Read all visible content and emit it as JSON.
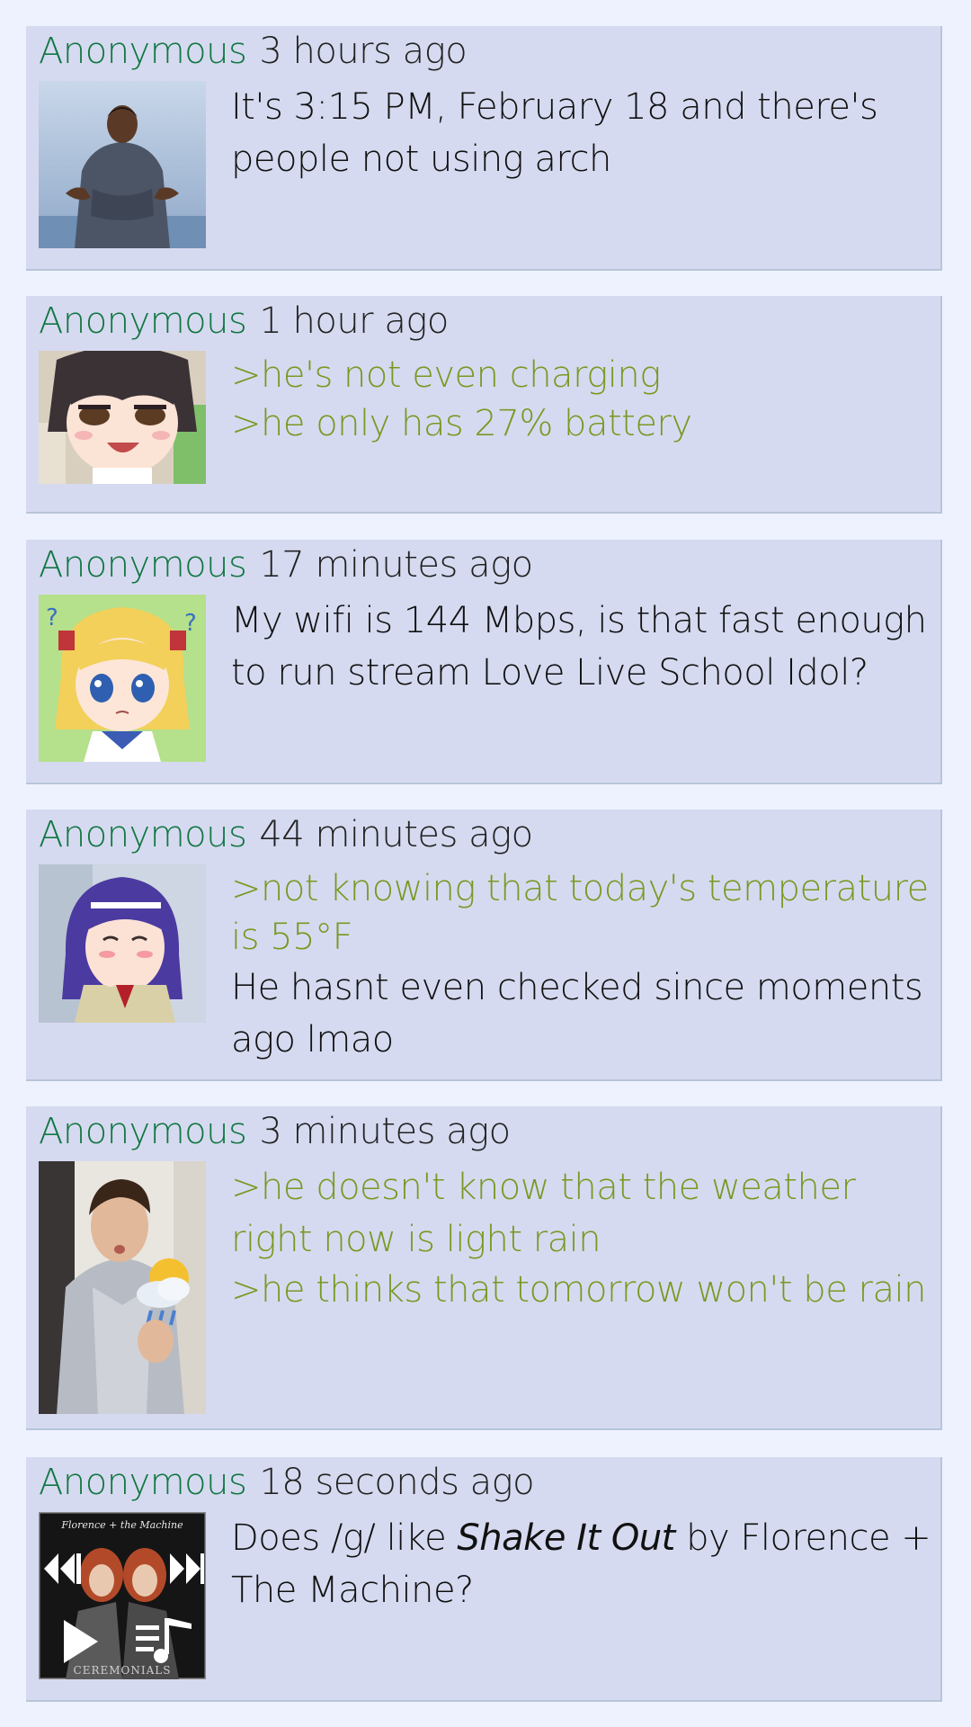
{
  "colors": {
    "background": "#eef2ff",
    "post_background": "#d6daf0",
    "post_border": "#b7c5d9",
    "author": "#117743",
    "greentext": "#789922",
    "text": "#111111"
  },
  "posts": [
    {
      "author": "Anonymous",
      "time": "3 hours ago",
      "thumbnail": "man-in-hoodie-image",
      "lines": [
        "It's 3:15 PM, February 18 and there's people not using arch"
      ]
    },
    {
      "author": "Anonymous",
      "time": "1 hour ago",
      "thumbnail": "smug-anime-girl-image",
      "quotes": [
        ">he's not even charging",
        ">he only has 27% battery"
      ]
    },
    {
      "author": "Anonymous",
      "time": "17 minutes ago",
      "thumbnail": "confused-anime-girl-image",
      "lines": [
        "My wifi is 144 Mbps, is that fast enough to run stream Love Live School Idol?"
      ]
    },
    {
      "author": "Anonymous",
      "time": "44 minutes ago",
      "thumbnail": "laughing-anime-girl-image",
      "quotes": [
        ">not knowing that today's temperature is 55°F"
      ],
      "lines": [
        "He hasnt even checked since moments ago lmao"
      ]
    },
    {
      "author": "Anonymous",
      "time": "3 minutes ago",
      "thumbnail": "man-holding-weather-icon-image",
      "quotes": [
        ">he doesn't know that the weather right now is light rain",
        ">he thinks that tomorrow won't be rain"
      ]
    },
    {
      "author": "Anonymous",
      "time": "18 seconds ago",
      "thumbnail": "album-cover-image",
      "album_cover_text": {
        "band": "Florence + the Machine",
        "album": "CEREMONIALS"
      },
      "text_parts": {
        "before": "Does /g/ like ",
        "song": "Shake It Out",
        "after": " by Florence + The Machine?"
      }
    }
  ]
}
